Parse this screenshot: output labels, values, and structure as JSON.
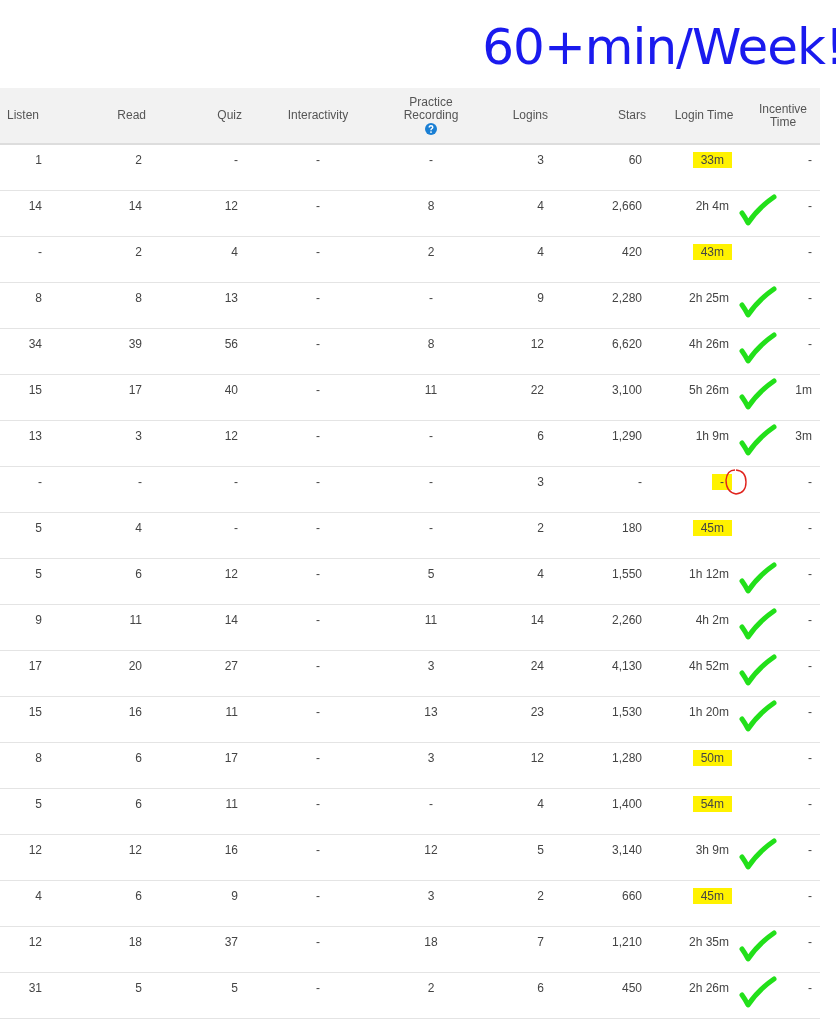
{
  "note": "60+min/Week!",
  "table": {
    "columns": [
      {
        "label": "Listen",
        "kind": "plain"
      },
      {
        "label": "Read",
        "kind": "plain"
      },
      {
        "label": "Quiz",
        "kind": "plain"
      },
      {
        "label": "Interactivity",
        "kind": "plain"
      },
      {
        "label": "Practice Recording",
        "kind": "help"
      },
      {
        "label": "Logins",
        "kind": "plain"
      },
      {
        "label": "Stars",
        "kind": "plain"
      },
      {
        "label": "Login Time",
        "kind": "plain"
      },
      {
        "label": "Incentive Time",
        "kind": "plain"
      }
    ],
    "rows": [
      {
        "cells": [
          "1",
          "2",
          "-",
          "-",
          "-",
          "3",
          "60",
          "33m",
          "-"
        ],
        "kind": "highlight"
      },
      {
        "cells": [
          "14",
          "14",
          "12",
          "-",
          "8",
          "4",
          "2,660",
          "2h 4m",
          "-"
        ],
        "kind": "check"
      },
      {
        "cells": [
          "-",
          "2",
          "4",
          "-",
          "2",
          "4",
          "420",
          "43m",
          "-"
        ],
        "kind": "highlight"
      },
      {
        "cells": [
          "8",
          "8",
          "13",
          "-",
          "-",
          "9",
          "2,280",
          "2h 25m",
          "-"
        ],
        "kind": "check"
      },
      {
        "cells": [
          "34",
          "39",
          "56",
          "-",
          "8",
          "12",
          "6,620",
          "4h 26m",
          "-"
        ],
        "kind": "check"
      },
      {
        "cells": [
          "15",
          "17",
          "40",
          "-",
          "11",
          "22",
          "3,100",
          "5h 26m",
          "1m"
        ],
        "kind": "check"
      },
      {
        "cells": [
          "13",
          "3",
          "12",
          "-",
          "-",
          "6",
          "1,290",
          "1h 9m",
          "3m"
        ],
        "kind": "check"
      },
      {
        "cells": [
          "-",
          "-",
          "-",
          "-",
          "-",
          "3",
          "-",
          "-",
          "-"
        ],
        "kind": "circled"
      },
      {
        "cells": [
          "5",
          "4",
          "-",
          "-",
          "-",
          "2",
          "180",
          "45m",
          "-"
        ],
        "kind": "highlight"
      },
      {
        "cells": [
          "5",
          "6",
          "12",
          "-",
          "5",
          "4",
          "1,550",
          "1h 12m",
          "-"
        ],
        "kind": "check"
      },
      {
        "cells": [
          "9",
          "11",
          "14",
          "-",
          "11",
          "14",
          "2,260",
          "4h 2m",
          "-"
        ],
        "kind": "check"
      },
      {
        "cells": [
          "17",
          "20",
          "27",
          "-",
          "3",
          "24",
          "4,130",
          "4h 52m",
          "-"
        ],
        "kind": "check"
      },
      {
        "cells": [
          "15",
          "16",
          "11",
          "-",
          "13",
          "23",
          "1,530",
          "1h 20m",
          "-"
        ],
        "kind": "check"
      },
      {
        "cells": [
          "8",
          "6",
          "17",
          "-",
          "3",
          "12",
          "1,280",
          "50m",
          "-"
        ],
        "kind": "highlight"
      },
      {
        "cells": [
          "5",
          "6",
          "11",
          "-",
          "-",
          "4",
          "1,400",
          "54m",
          "-"
        ],
        "kind": "highlight"
      },
      {
        "cells": [
          "12",
          "12",
          "16",
          "-",
          "12",
          "5",
          "3,140",
          "3h 9m",
          "-"
        ],
        "kind": "check"
      },
      {
        "cells": [
          "4",
          "6",
          "9",
          "-",
          "3",
          "2",
          "660",
          "45m",
          "-"
        ],
        "kind": "highlight"
      },
      {
        "cells": [
          "12",
          "18",
          "37",
          "-",
          "18",
          "7",
          "1,210",
          "2h 35m",
          "-"
        ],
        "kind": "check"
      },
      {
        "cells": [
          "31",
          "5",
          "5",
          "-",
          "2",
          "6",
          "450",
          "2h 26m",
          "-"
        ],
        "kind": "check"
      }
    ]
  }
}
